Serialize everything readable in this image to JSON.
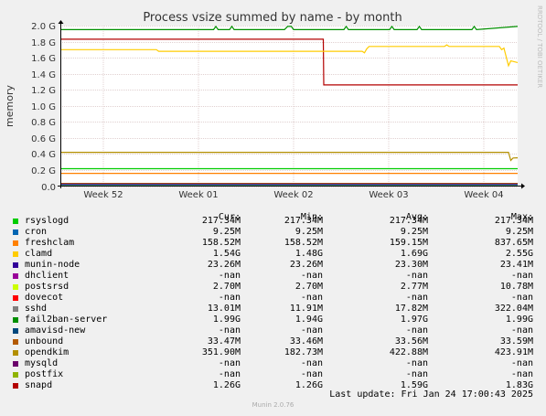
{
  "sidetext": "RRDTOOL / TOBI OETIKER",
  "footer": "Munin 2.0.76",
  "last_update": "Last update: Fri Jan 24 17:00:43 2025",
  "legend_headers": {
    "cur": "Cur:",
    "min": "Min:",
    "avg": "Avg:",
    "max": "Max:"
  },
  "legend": [
    {
      "name": "rsyslogd",
      "color": "#00cc00",
      "cur": "217.34M",
      "min": "217.34M",
      "avg": "217.34M",
      "max": "217.34M"
    },
    {
      "name": "cron",
      "color": "#0066b3",
      "cur": "9.25M",
      "min": "9.25M",
      "avg": "9.25M",
      "max": "9.25M"
    },
    {
      "name": "freshclam",
      "color": "#ff8000",
      "cur": "158.52M",
      "min": "158.52M",
      "avg": "159.15M",
      "max": "837.65M"
    },
    {
      "name": "clamd",
      "color": "#ffcc00",
      "cur": "1.54G",
      "min": "1.48G",
      "avg": "1.69G",
      "max": "2.55G"
    },
    {
      "name": "munin-node",
      "color": "#330099",
      "cur": "23.26M",
      "min": "23.26M",
      "avg": "23.30M",
      "max": "23.41M"
    },
    {
      "name": "dhclient",
      "color": "#990099",
      "cur": "-nan",
      "min": "-nan",
      "avg": "-nan",
      "max": "-nan"
    },
    {
      "name": "postsrsd",
      "color": "#ccff00",
      "cur": "2.70M",
      "min": "2.70M",
      "avg": "2.77M",
      "max": "10.78M"
    },
    {
      "name": "dovecot",
      "color": "#ff0000",
      "cur": "-nan",
      "min": "-nan",
      "avg": "-nan",
      "max": "-nan"
    },
    {
      "name": "sshd",
      "color": "#808080",
      "cur": "13.01M",
      "min": "11.91M",
      "avg": "17.82M",
      "max": "322.04M"
    },
    {
      "name": "fail2ban-server",
      "color": "#008f00",
      "cur": "1.99G",
      "min": "1.94G",
      "avg": "1.97G",
      "max": "1.99G"
    },
    {
      "name": "amavisd-new",
      "color": "#00487d",
      "cur": "-nan",
      "min": "-nan",
      "avg": "-nan",
      "max": "-nan"
    },
    {
      "name": "unbound",
      "color": "#b35a00",
      "cur": "33.47M",
      "min": "33.46M",
      "avg": "33.56M",
      "max": "33.59M"
    },
    {
      "name": "opendkim",
      "color": "#b38f00",
      "cur": "351.90M",
      "min": "182.73M",
      "avg": "422.88M",
      "max": "423.91M"
    },
    {
      "name": "mysqld",
      "color": "#6b006b",
      "cur": "-nan",
      "min": "-nan",
      "avg": "-nan",
      "max": "-nan"
    },
    {
      "name": "postfix",
      "color": "#8fb300",
      "cur": "-nan",
      "min": "-nan",
      "avg": "-nan",
      "max": "-nan"
    },
    {
      "name": "snapd",
      "color": "#b30000",
      "cur": "1.26G",
      "min": "1.26G",
      "avg": "1.59G",
      "max": "1.83G"
    }
  ],
  "chart_data": {
    "type": "line",
    "title": "Process vsize summed by name - by month",
    "xlabel": "",
    "ylabel": "memory",
    "ylim": [
      0,
      2.0
    ],
    "y_unit": "G",
    "yticks": [
      "0.0",
      "0.2 G",
      "0.4 G",
      "0.6 G",
      "0.8 G",
      "1.0 G",
      "1.2 G",
      "1.4 G",
      "1.6 G",
      "1.8 G",
      "2.0 G"
    ],
    "ytick_values": [
      0,
      0.2,
      0.4,
      0.6,
      0.8,
      1.0,
      1.2,
      1.4,
      1.6,
      1.8,
      2.0
    ],
    "xlim": [
      0,
      1
    ],
    "xticks": [
      {
        "label": "Week 52",
        "x": 0.094
      },
      {
        "label": "Week 01",
        "x": 0.302
      },
      {
        "label": "Week 02",
        "x": 0.51
      },
      {
        "label": "Week 03",
        "x": 0.718
      },
      {
        "label": "Week 04",
        "x": 0.926
      }
    ],
    "grid": true,
    "legend_position": "bottom",
    "series": [
      {
        "name": "fail2ban-server",
        "color": "#008f00",
        "x": [
          0,
          0.335,
          0.34,
          0.345,
          0.37,
          0.375,
          0.38,
          0.49,
          0.497,
          0.505,
          0.51,
          0.62,
          0.625,
          0.63,
          0.72,
          0.725,
          0.73,
          0.78,
          0.785,
          0.79,
          0.9,
          0.905,
          0.91,
          1.0
        ],
        "values": [
          1.95,
          1.95,
          1.99,
          1.95,
          1.95,
          1.99,
          1.95,
          1.95,
          1.99,
          1.99,
          1.95,
          1.95,
          1.99,
          1.95,
          1.95,
          1.99,
          1.95,
          1.95,
          1.99,
          1.95,
          1.95,
          1.99,
          1.95,
          1.99
        ]
      },
      {
        "name": "snapd",
        "color": "#b30000",
        "x": [
          0,
          0.575,
          0.576,
          1.0
        ],
        "values": [
          1.83,
          1.83,
          1.26,
          1.26
        ]
      },
      {
        "name": "clamd",
        "color": "#ffcc00",
        "x": [
          0,
          0.21,
          0.215,
          0.66,
          0.665,
          0.67,
          0.675,
          0.7,
          0.705,
          0.84,
          0.845,
          0.85,
          0.96,
          0.965,
          0.97,
          0.98,
          0.985,
          1.0
        ],
        "values": [
          1.7,
          1.7,
          1.68,
          1.68,
          1.66,
          1.71,
          1.74,
          1.74,
          1.74,
          1.74,
          1.76,
          1.74,
          1.74,
          1.7,
          1.72,
          1.5,
          1.56,
          1.54
        ]
      },
      {
        "name": "opendkim",
        "color": "#b38f00",
        "x": [
          0,
          0.98,
          0.985,
          0.99,
          1.0
        ],
        "values": [
          0.42,
          0.42,
          0.32,
          0.35,
          0.352
        ]
      },
      {
        "name": "rsyslogd",
        "color": "#00cc00",
        "x": [
          0,
          1.0
        ],
        "values": [
          0.217,
          0.217
        ]
      },
      {
        "name": "freshclam",
        "color": "#ff8000",
        "x": [
          0,
          1.0
        ],
        "values": [
          0.1585,
          0.1585
        ]
      },
      {
        "name": "unbound",
        "color": "#b35a00",
        "x": [
          0,
          1.0
        ],
        "values": [
          0.0335,
          0.0335
        ]
      },
      {
        "name": "munin-node",
        "color": "#330099",
        "x": [
          0,
          1.0
        ],
        "values": [
          0.0233,
          0.0233
        ]
      },
      {
        "name": "sshd",
        "color": "#808080",
        "x": [
          0,
          1.0
        ],
        "values": [
          0.013,
          0.013
        ]
      },
      {
        "name": "cron",
        "color": "#0066b3",
        "x": [
          0,
          1.0
        ],
        "values": [
          0.00925,
          0.00925
        ]
      },
      {
        "name": "postsrsd",
        "color": "#ccff00",
        "x": [
          0,
          1.0
        ],
        "values": [
          0.0027,
          0.0027
        ]
      }
    ]
  }
}
